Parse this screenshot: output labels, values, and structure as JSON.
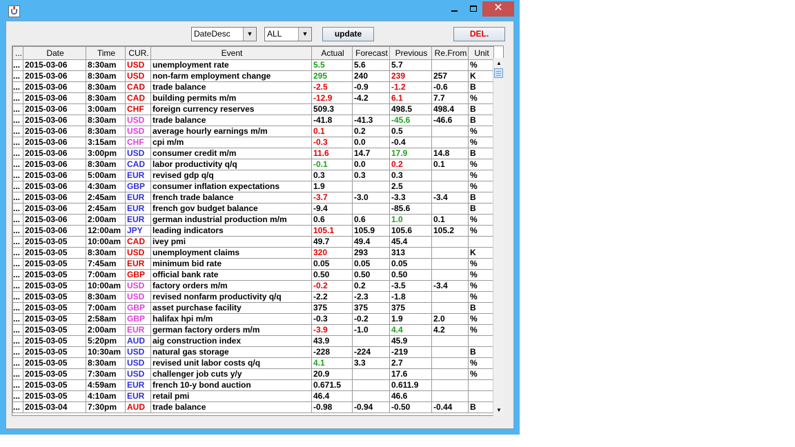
{
  "window": {
    "close_symbol": "✕"
  },
  "toolbar": {
    "sort_value": "DateDesc",
    "filter_value": "ALL",
    "update_label": "update",
    "del_label": "DEL."
  },
  "colors": {
    "red": "#e00000",
    "blue": "#2e2ed8",
    "pink": "#e040d8",
    "green": "#1aa01a"
  },
  "table": {
    "columns": [
      "...",
      "Date",
      "Time",
      "CUR.",
      "Event",
      "Actual",
      "Forecast",
      "Previous",
      "Re.From",
      "Unit"
    ],
    "rows": [
      {
        "dots": "...",
        "date": "2015-03-06",
        "time": "8:30am",
        "cur": "USD",
        "cc": "red",
        "event": "unemployment rate",
        "actual": "5.5",
        "ac": "green",
        "forecast": "5.6",
        "previous": "5.7",
        "pc": "",
        "refrom": "",
        "unit": "%"
      },
      {
        "dots": "...",
        "date": "2015-03-06",
        "time": "8:30am",
        "cur": "USD",
        "cc": "red",
        "event": "non-farm employment change",
        "actual": "295",
        "ac": "green",
        "forecast": "240",
        "previous": "239",
        "pc": "red",
        "refrom": "257",
        "unit": "K"
      },
      {
        "dots": "...",
        "date": "2015-03-06",
        "time": "8:30am",
        "cur": "CAD",
        "cc": "red",
        "event": "trade balance",
        "actual": "-2.5",
        "ac": "red",
        "forecast": "-0.9",
        "previous": "-1.2",
        "pc": "red",
        "refrom": "-0.6",
        "unit": "B"
      },
      {
        "dots": "...",
        "date": "2015-03-06",
        "time": "8:30am",
        "cur": "CAD",
        "cc": "red",
        "event": "building permits m/m",
        "actual": "-12.9",
        "ac": "red",
        "forecast": "-4.2",
        "previous": "6.1",
        "pc": "red",
        "refrom": "7.7",
        "unit": "%"
      },
      {
        "dots": "...",
        "date": "2015-03-06",
        "time": "3:00am",
        "cur": "CHF",
        "cc": "red",
        "event": "foreign currency reserves",
        "actual": "509.3",
        "ac": "",
        "forecast": "",
        "previous": "498.5",
        "pc": "",
        "refrom": "498.4",
        "unit": "B"
      },
      {
        "dots": "...",
        "date": "2015-03-06",
        "time": "8:30am",
        "cur": "USD",
        "cc": "pink",
        "event": "trade balance",
        "actual": "-41.8",
        "ac": "",
        "forecast": "-41.3",
        "previous": "-45.6",
        "pc": "green",
        "refrom": "-46.6",
        "unit": "B"
      },
      {
        "dots": "...",
        "date": "2015-03-06",
        "time": "8:30am",
        "cur": "USD",
        "cc": "pink",
        "event": "average hourly earnings m/m",
        "actual": "0.1",
        "ac": "red",
        "forecast": "0.2",
        "previous": "0.5",
        "pc": "",
        "refrom": "",
        "unit": "%"
      },
      {
        "dots": "...",
        "date": "2015-03-06",
        "time": "3:15am",
        "cur": "CHF",
        "cc": "pink",
        "event": "cpi m/m",
        "actual": "-0.3",
        "ac": "red",
        "forecast": "0.0",
        "previous": "-0.4",
        "pc": "",
        "refrom": "",
        "unit": "%"
      },
      {
        "dots": "...",
        "date": "2015-03-06",
        "time": "3:00pm",
        "cur": "USD",
        "cc": "blue",
        "event": "consumer credit m/m",
        "actual": "11.6",
        "ac": "red",
        "forecast": "14.7",
        "previous": "17.9",
        "pc": "green",
        "refrom": "14.8",
        "unit": "B"
      },
      {
        "dots": "...",
        "date": "2015-03-06",
        "time": "8:30am",
        "cur": "CAD",
        "cc": "blue",
        "event": "labor productivity q/q",
        "actual": "-0.1",
        "ac": "green",
        "forecast": "0.0",
        "previous": "0.2",
        "pc": "red",
        "refrom": "0.1",
        "unit": "%"
      },
      {
        "dots": "...",
        "date": "2015-03-06",
        "time": "5:00am",
        "cur": "EUR",
        "cc": "blue",
        "event": "revised gdp q/q",
        "actual": "0.3",
        "ac": "",
        "forecast": "0.3",
        "previous": "0.3",
        "pc": "",
        "refrom": "",
        "unit": "%"
      },
      {
        "dots": "...",
        "date": "2015-03-06",
        "time": "4:30am",
        "cur": "GBP",
        "cc": "blue",
        "event": "consumer inflation expectations",
        "actual": "1.9",
        "ac": "",
        "forecast": "",
        "previous": "2.5",
        "pc": "",
        "refrom": "",
        "unit": "%"
      },
      {
        "dots": "...",
        "date": "2015-03-06",
        "time": "2:45am",
        "cur": "EUR",
        "cc": "blue",
        "event": "french trade balance",
        "actual": "-3.7",
        "ac": "red",
        "forecast": "-3.0",
        "previous": "-3.3",
        "pc": "",
        "refrom": "-3.4",
        "unit": "B"
      },
      {
        "dots": "...",
        "date": "2015-03-06",
        "time": "2:45am",
        "cur": "EUR",
        "cc": "blue",
        "event": "french gov budget balance",
        "actual": "-9.4",
        "ac": "",
        "forecast": "",
        "previous": "-85.6",
        "pc": "",
        "refrom": "",
        "unit": "B"
      },
      {
        "dots": "...",
        "date": "2015-03-06",
        "time": "2:00am",
        "cur": "EUR",
        "cc": "blue",
        "event": "german industrial production m/m",
        "actual": "0.6",
        "ac": "",
        "forecast": "0.6",
        "previous": "1.0",
        "pc": "green",
        "refrom": "0.1",
        "unit": "%"
      },
      {
        "dots": "...",
        "date": "2015-03-06",
        "time": "12:00am",
        "cur": "JPY",
        "cc": "blue",
        "event": "leading indicators",
        "actual": "105.1",
        "ac": "red",
        "forecast": "105.9",
        "previous": "105.6",
        "pc": "",
        "refrom": "105.2",
        "unit": "%"
      },
      {
        "dots": "...",
        "date": "2015-03-05",
        "time": "10:00am",
        "cur": "CAD",
        "cc": "red",
        "event": "ivey pmi",
        "actual": "49.7",
        "ac": "",
        "forecast": "49.4",
        "previous": "45.4",
        "pc": "",
        "refrom": "",
        "unit": ""
      },
      {
        "dots": "...",
        "date": "2015-03-05",
        "time": "8:30am",
        "cur": "USD",
        "cc": "red",
        "event": "unemployment claims",
        "actual": "320",
        "ac": "red",
        "forecast": "293",
        "previous": "313",
        "pc": "",
        "refrom": "",
        "unit": "K"
      },
      {
        "dots": "...",
        "date": "2015-03-05",
        "time": "7:45am",
        "cur": "EUR",
        "cc": "red",
        "event": "minimum bid rate",
        "actual": "0.05",
        "ac": "",
        "forecast": "0.05",
        "previous": "0.05",
        "pc": "",
        "refrom": "",
        "unit": "%"
      },
      {
        "dots": "...",
        "date": "2015-03-05",
        "time": "7:00am",
        "cur": "GBP",
        "cc": "red",
        "event": "official bank rate",
        "actual": "0.50",
        "ac": "",
        "forecast": "0.50",
        "previous": "0.50",
        "pc": "",
        "refrom": "",
        "unit": "%"
      },
      {
        "dots": "...",
        "date": "2015-03-05",
        "time": "10:00am",
        "cur": "USD",
        "cc": "pink",
        "event": "factory orders m/m",
        "actual": "-0.2",
        "ac": "red",
        "forecast": "0.2",
        "previous": "-3.5",
        "pc": "",
        "refrom": "-3.4",
        "unit": "%"
      },
      {
        "dots": "...",
        "date": "2015-03-05",
        "time": "8:30am",
        "cur": "USD",
        "cc": "pink",
        "event": "revised nonfarm productivity q/q",
        "actual": "-2.2",
        "ac": "",
        "forecast": "-2.3",
        "previous": "-1.8",
        "pc": "",
        "refrom": "",
        "unit": "%"
      },
      {
        "dots": "...",
        "date": "2015-03-05",
        "time": "7:00am",
        "cur": "GBP",
        "cc": "pink",
        "event": "asset purchase facility",
        "actual": "375",
        "ac": "",
        "forecast": "375",
        "previous": "375",
        "pc": "",
        "refrom": "",
        "unit": "B"
      },
      {
        "dots": "...",
        "date": "2015-03-05",
        "time": "2:58am",
        "cur": "GBP",
        "cc": "pink",
        "event": "halifax hpi m/m",
        "actual": "-0.3",
        "ac": "",
        "forecast": "-0.2",
        "previous": "1.9",
        "pc": "",
        "refrom": "2.0",
        "unit": "%"
      },
      {
        "dots": "...",
        "date": "2015-03-05",
        "time": "2:00am",
        "cur": "EUR",
        "cc": "pink",
        "event": "german factory orders m/m",
        "actual": "-3.9",
        "ac": "red",
        "forecast": "-1.0",
        "previous": "4.4",
        "pc": "green",
        "refrom": "4.2",
        "unit": "%"
      },
      {
        "dots": "...",
        "date": "2015-03-05",
        "time": "5:20pm",
        "cur": "AUD",
        "cc": "blue",
        "event": "aig construction index",
        "actual": "43.9",
        "ac": "",
        "forecast": "",
        "previous": "45.9",
        "pc": "",
        "refrom": "",
        "unit": ""
      },
      {
        "dots": "...",
        "date": "2015-03-05",
        "time": "10:30am",
        "cur": "USD",
        "cc": "blue",
        "event": "natural gas storage",
        "actual": "-228",
        "ac": "",
        "forecast": "-224",
        "previous": "-219",
        "pc": "",
        "refrom": "",
        "unit": "B"
      },
      {
        "dots": "...",
        "date": "2015-03-05",
        "time": "8:30am",
        "cur": "USD",
        "cc": "blue",
        "event": "revised unit labor costs q/q",
        "actual": "4.1",
        "ac": "green",
        "forecast": "3.3",
        "previous": "2.7",
        "pc": "",
        "refrom": "",
        "unit": "%"
      },
      {
        "dots": "...",
        "date": "2015-03-05",
        "time": "7:30am",
        "cur": "USD",
        "cc": "blue",
        "event": "challenger job cuts y/y",
        "actual": "20.9",
        "ac": "",
        "forecast": "",
        "previous": "17.6",
        "pc": "",
        "refrom": "",
        "unit": "%"
      },
      {
        "dots": "...",
        "date": "2015-03-05",
        "time": "4:59am",
        "cur": "EUR",
        "cc": "blue",
        "event": "french 10-y bond auction",
        "actual": "0.671.5",
        "ac": "",
        "forecast": "",
        "previous": "0.611.9",
        "pc": "",
        "refrom": "",
        "unit": ""
      },
      {
        "dots": "...",
        "date": "2015-03-05",
        "time": "4:10am",
        "cur": "EUR",
        "cc": "blue",
        "event": "retail pmi",
        "actual": "46.4",
        "ac": "",
        "forecast": "",
        "previous": "46.6",
        "pc": "",
        "refrom": "",
        "unit": ""
      },
      {
        "dots": "...",
        "date": "2015-03-04",
        "time": "7:30pm",
        "cur": "AUD",
        "cc": "red",
        "event": "trade balance",
        "actual": "-0.98",
        "ac": "",
        "forecast": "-0.94",
        "previous": "-0.50",
        "pc": "",
        "refrom": "-0.44",
        "unit": "B"
      }
    ]
  }
}
